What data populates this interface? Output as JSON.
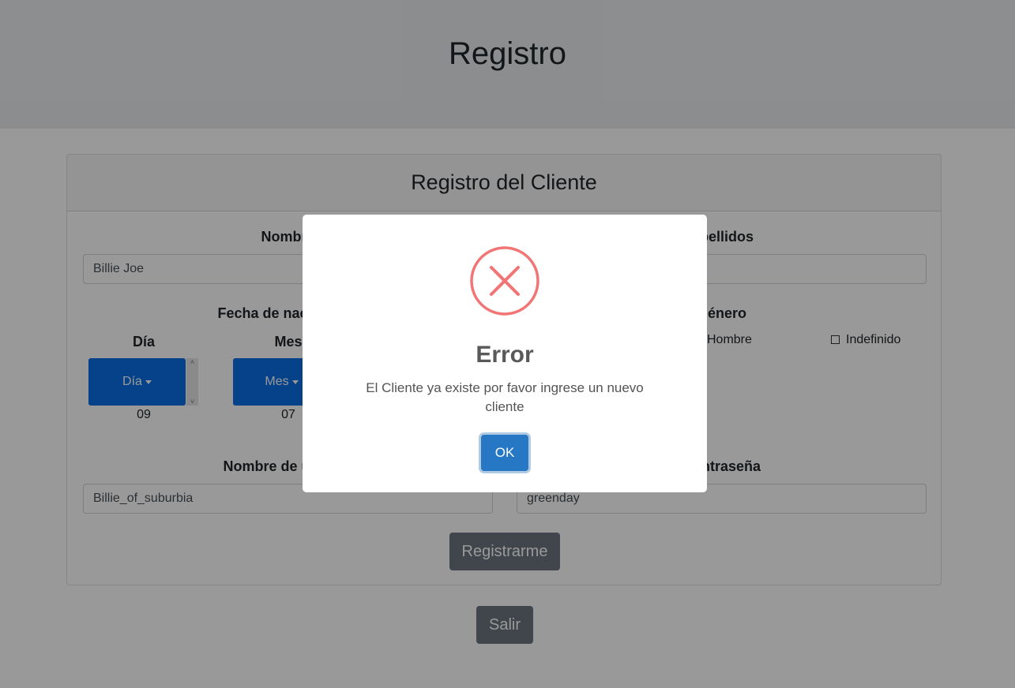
{
  "header": {
    "title": "Registro"
  },
  "card": {
    "title": "Registro del Cliente"
  },
  "form": {
    "nombre_label": "Nombre",
    "nombre_value": "Billie Joe",
    "apellidos_label": "Apellidos",
    "fecha_label": "Fecha de nacimiento",
    "dia_label": "Día",
    "dia_button": "Día",
    "dia_value": "09",
    "mes_label": "Mes",
    "mes_button": "Mes",
    "mes_value": "07",
    "genero_label": "Género",
    "genero_options": [
      "Hombre",
      "Indefinido"
    ],
    "usuario_label": "Nombre de usuario",
    "usuario_value": "Billie_of_suburbia",
    "contrasena_label": "Contraseña",
    "contrasena_value": "greenday",
    "submit_label": "Registrarme"
  },
  "exit_label": "Salir",
  "modal": {
    "title": "Error",
    "message": "El Cliente ya existe por favor ingrese un nuevo cliente",
    "ok_label": "OK",
    "icon": "error-x-icon",
    "icon_color": "#f27474"
  }
}
